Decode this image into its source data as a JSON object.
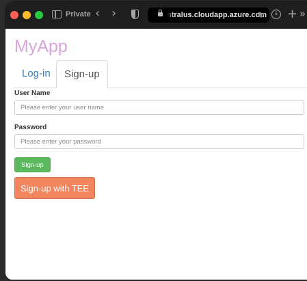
{
  "browser": {
    "private_label": "Private",
    "url_display": "ntralus.cloudapp.azure.com",
    "traffic_light_colors": [
      "#ff5f57",
      "#febc2e",
      "#28c840"
    ],
    "icons": [
      "sidebar-icon",
      "back-icon",
      "forward-icon",
      "shield-icon",
      "lock-icon",
      "reload-icon",
      "download-icon",
      "new-tab-icon",
      "more-tabs-icon"
    ]
  },
  "app": {
    "title": "MyApp",
    "brand_color": "#d9a5dd"
  },
  "tabs": [
    {
      "label": "Log-in",
      "active": false
    },
    {
      "label": "Sign-up",
      "active": true
    }
  ],
  "form": {
    "username_label": "User Name",
    "username_placeholder": "Please enter your user name",
    "password_label": "Password",
    "password_placeholder": "Please enter your password",
    "signup_button": "Sign-up",
    "signup_tee_button": "Sign-up with TEE"
  },
  "colors": {
    "signup_button": "#5cb85c",
    "signup_tee_button": "#f0855e",
    "tab_link": "#337ab7"
  }
}
